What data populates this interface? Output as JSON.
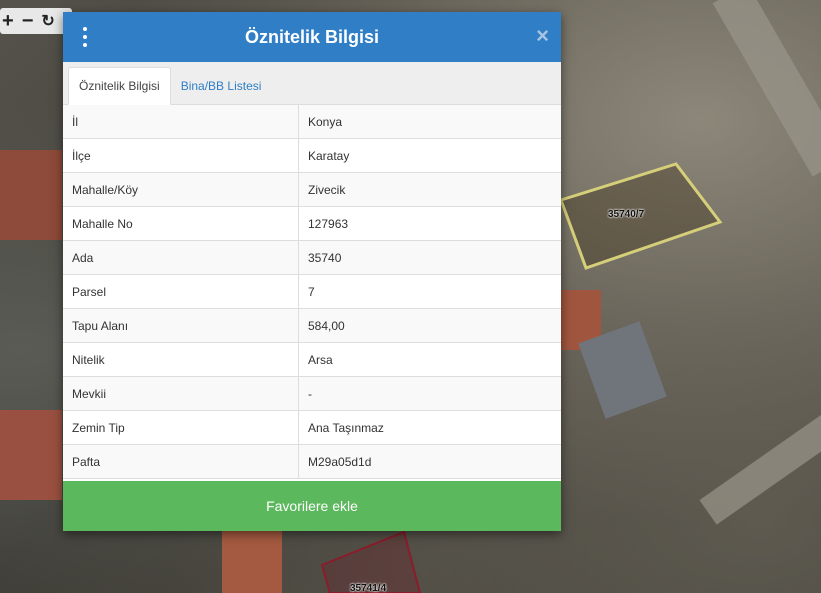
{
  "map": {
    "parcel_labels": [
      "35740/7",
      "35741/4"
    ],
    "parcel_colors": {
      "selected": "#d6cf7a",
      "other": "#8b1c2a"
    }
  },
  "dialog": {
    "title": "Öznitelik Bilgisi",
    "close_glyph": "×",
    "tabs": [
      {
        "label": "Öznitelik Bilgisi",
        "active": true
      },
      {
        "label": "Bina/BB Listesi",
        "active": false
      }
    ],
    "rows": [
      {
        "key": "İl",
        "value": "Konya"
      },
      {
        "key": "İlçe",
        "value": "Karatay"
      },
      {
        "key": "Mahalle/Köy",
        "value": "Zivecik"
      },
      {
        "key": "Mahalle No",
        "value": "127963"
      },
      {
        "key": "Ada",
        "value": "35740"
      },
      {
        "key": "Parsel",
        "value": "7"
      },
      {
        "key": "Tapu Alanı",
        "value": "584,00"
      },
      {
        "key": "Nitelik",
        "value": "Arsa"
      },
      {
        "key": "Mevkii",
        "value": "-"
      },
      {
        "key": "Zemin Tip",
        "value": "Ana Taşınmaz"
      },
      {
        "key": "Pafta",
        "value": "M29a05d1d"
      }
    ],
    "favorite_button": "Favorilere ekle"
  },
  "colors": {
    "header": "#2f7ec6",
    "button": "#5cb85c"
  }
}
